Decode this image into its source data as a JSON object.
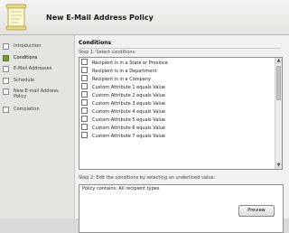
{
  "window": {
    "title": "New E-Mail Address Policy"
  },
  "nav": {
    "items": [
      {
        "label": "Introduction",
        "state": "done"
      },
      {
        "label": "Conditions",
        "state": "active"
      },
      {
        "label": "E-Mail Addresses",
        "state": "pending"
      },
      {
        "label": "Schedule",
        "state": "pending"
      },
      {
        "label": "New E-mail Address Policy",
        "state": "pending"
      },
      {
        "label": "Completion",
        "state": "pending"
      }
    ]
  },
  "content": {
    "title": "Conditions",
    "step1_label": "Step 1: Select conditions:",
    "conditions": [
      "Recipient is in a State or Province",
      "Recipient is in a Department",
      "Recipient is in a Company",
      "Custom Attribute 1 equals Value",
      "Custom Attribute 2 equals Value",
      "Custom Attribute 3 equals Value",
      "Custom Attribute 4 equals Value",
      "Custom Attribute 5 equals Value",
      "Custom Attribute 6 equals Value",
      "Custom Attribute 7 equals Value"
    ],
    "step2_label": "Step 2: Edit the conditions by selecting an underlined value:",
    "description": "Policy contains:  All recipient types",
    "preview_label": "Preview"
  },
  "colors": {
    "active_step": "#7a9a3a",
    "header_bg": "#e9e9e6"
  }
}
